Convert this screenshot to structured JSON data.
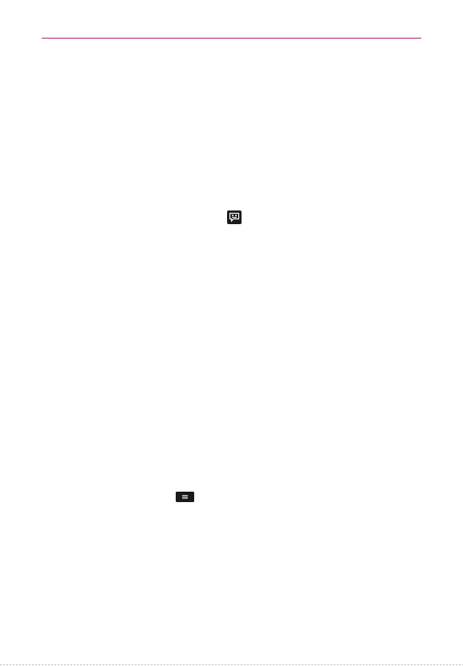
{
  "colors": {
    "accent_rule": "#b5197e",
    "icon_fill": "#1a1a1a",
    "icon_glyph": "#ffffff",
    "footer_rule": "#b8b8b8"
  },
  "icons": {
    "messaging": "messaging-icon",
    "menu_key": "menu-key-icon"
  }
}
